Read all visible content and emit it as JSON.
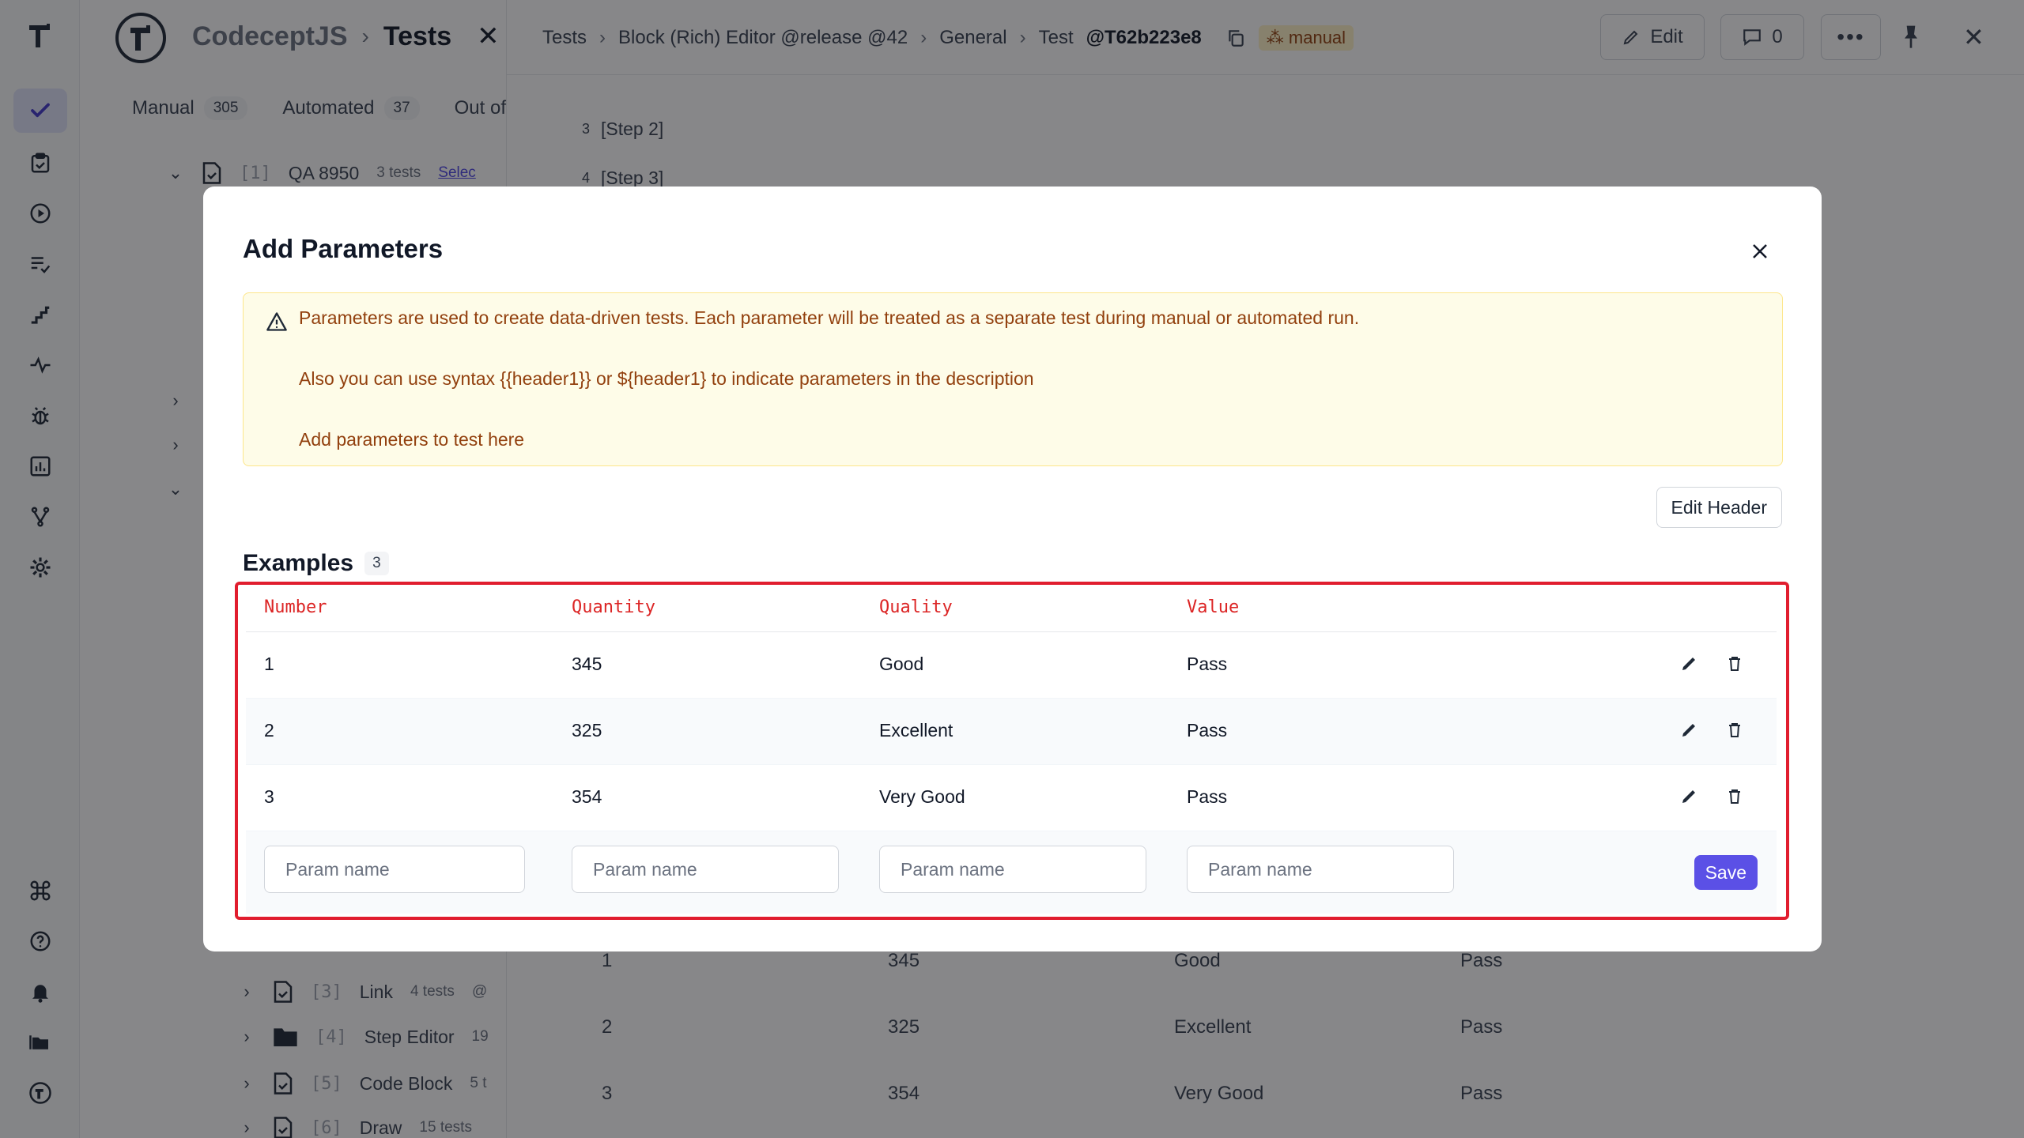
{
  "app": {
    "name": "CodeceptJS",
    "section": "Tests"
  },
  "tree": {
    "tabs": [
      {
        "label": "Manual",
        "count": "305"
      },
      {
        "label": "Automated",
        "count": "37"
      },
      {
        "label": "Out of"
      }
    ],
    "suite": {
      "index": "[1]",
      "name": "QA 8950",
      "count": "3 tests",
      "link": "Selec"
    },
    "items": [
      {
        "index": "[3]",
        "name": "Link",
        "count": "4 tests",
        "extra": "@"
      },
      {
        "index": "[4]",
        "name": "Step Editor",
        "count": "19"
      },
      {
        "index": "[5]",
        "name": "Code Block",
        "count": "5 t"
      },
      {
        "index": "[6]",
        "name": "Draw",
        "count": "15 tests"
      }
    ]
  },
  "detail": {
    "breadcrumb": [
      "Tests",
      "Block (Rich) Editor @release @42",
      "General"
    ],
    "test_label": "Test",
    "test_id": "@T62b223e8",
    "tag": "manual",
    "edit_label": "Edit",
    "comments_count": "0",
    "steps": [
      {
        "n": "3",
        "text": "[Step 2]"
      },
      {
        "n": "4",
        "text": "[Step 3]"
      }
    ],
    "bg_rows": [
      {
        "number": "1",
        "quantity": "345",
        "quality": "Good",
        "value": "Pass"
      },
      {
        "number": "2",
        "quantity": "325",
        "quality": "Excellent",
        "value": "Pass"
      },
      {
        "number": "3",
        "quantity": "354",
        "quality": "Very Good",
        "value": "Pass"
      }
    ]
  },
  "modal": {
    "title": "Add Parameters",
    "alert": [
      "Parameters are used to create data-driven tests. Each parameter will be treated as a separate test during manual or automated run.",
      "Also you can use syntax {{header1}} or ${header1} to indicate parameters in the description",
      "Add parameters to test here"
    ],
    "edit_header_label": "Edit Header",
    "examples_label": "Examples",
    "examples_count": "3",
    "columns": [
      "Number",
      "Quantity",
      "Quality",
      "Value"
    ],
    "rows": [
      {
        "number": "1",
        "quantity": "345",
        "quality": "Good",
        "value": "Pass"
      },
      {
        "number": "2",
        "quantity": "325",
        "quality": "Excellent",
        "value": "Pass"
      },
      {
        "number": "3",
        "quantity": "354",
        "quality": "Very Good",
        "value": "Pass"
      }
    ],
    "input_placeholder": "Param name",
    "save_label": "Save"
  },
  "colors": {
    "accent": "#5b50e6",
    "highlight_border": "#e11d2e",
    "header_text": "#dc2626",
    "alert_bg": "#fefce8",
    "alert_text": "#92400e"
  },
  "icons": [
    "logo-icon",
    "check-icon",
    "clipboard-check-icon",
    "play-circle-icon",
    "list-check-icon",
    "steps-icon",
    "pulse-icon",
    "bug-icon",
    "bar-chart-icon",
    "branch-icon",
    "gear-icon",
    "command-icon",
    "help-icon",
    "bell-icon",
    "folders-icon",
    "close-icon",
    "copy-icon",
    "pencil-icon",
    "comment-icon",
    "more-icon",
    "pin-icon",
    "warning-icon",
    "trash-icon",
    "file-check-icon",
    "folder-icon",
    "chevron-right-icon",
    "chevron-down-icon"
  ]
}
